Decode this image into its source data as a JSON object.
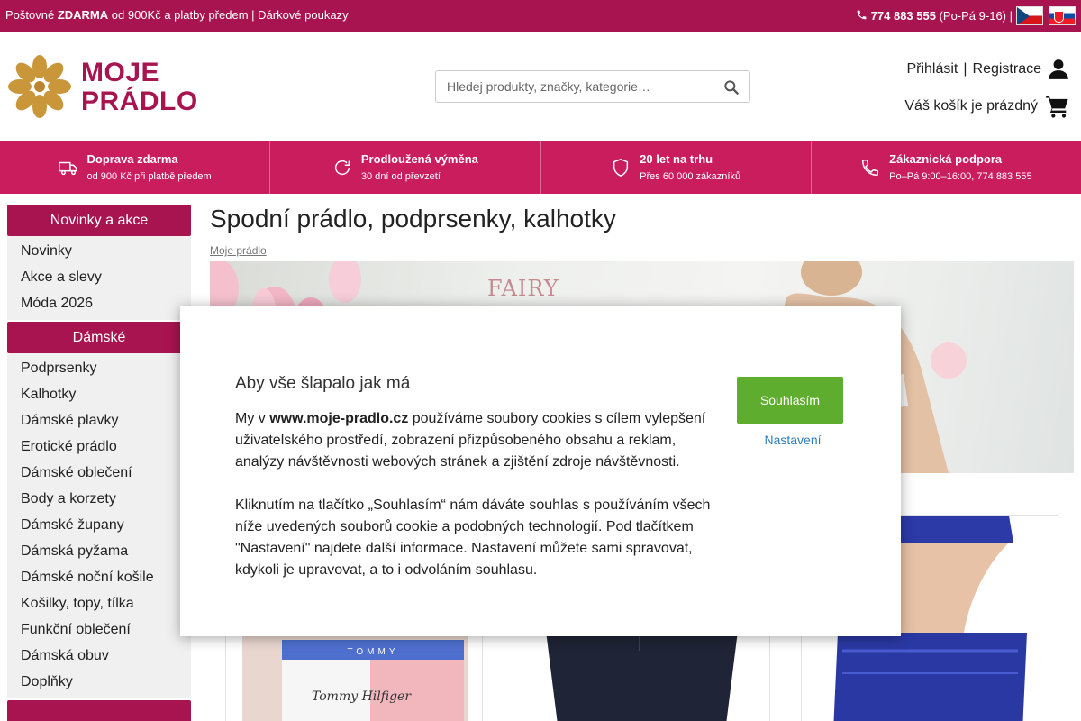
{
  "topbar": {
    "promo_prefix": "Poštovné ",
    "promo_bold": "ZDARMA",
    "promo_suffix": " od 900Kč a platby předem | Dárkové poukazy",
    "phone": "774 883 555",
    "hours": " (Po-Pá 9-16) |",
    "languages": [
      "cz",
      "sk"
    ]
  },
  "header": {
    "logo_line1": "MOJE",
    "logo_line2": "PRÁDLO",
    "search_placeholder": "Hledej produkty, značky, kategorie…",
    "login": "Přihlásit",
    "separator": "|",
    "register": "Registrace",
    "cart": "Váš košík je prázdný"
  },
  "benefits": [
    {
      "title": "Doprava zdarma",
      "subtitle": "od 900 Kč při platbě předem",
      "icon": "truck-icon"
    },
    {
      "title": "Prodloužená výměna",
      "subtitle": "30 dní od převzetí",
      "icon": "refresh-icon"
    },
    {
      "title": "20 let na trhu",
      "subtitle": "Přes 60 000 zákazníků",
      "icon": "shield-icon"
    },
    {
      "title": "Zákaznická podpora",
      "subtitle": "Po–Pá 9:00–16:00, 774 883 555",
      "icon": "phone-icon"
    }
  ],
  "sidebar": {
    "groups": [
      {
        "title": "Novinky a akce",
        "items": [
          "Novinky",
          "Akce a slevy",
          "Móda 2026"
        ]
      },
      {
        "title": "Dámské",
        "items": [
          "Podprsenky",
          "Kalhotky",
          "Dámské plavky",
          "Erotické prádlo",
          "Dámské oblečení",
          "Body a korzety",
          "Dámské župany",
          "Dámská pyžama",
          "Dámské noční košile",
          "Košilky, topy, tílka",
          "Funkční oblečení",
          "Dámská obuv",
          "Doplňky"
        ]
      }
    ]
  },
  "main": {
    "title": "Spodní prádlo, podprsenky, kalhotky",
    "breadcrumb": "Moje prádlo",
    "banner_brand": "FAIRY",
    "product_brand_1": "TOMMY",
    "product_brand_1_script": "Tommy Hilfiger"
  },
  "cookie": {
    "title": "Aby vše šlapalo jak má",
    "p1_prefix": "My v ",
    "p1_site": "www.moje-pradlo.cz",
    "p1_suffix": " používáme soubory cookies s cílem vylepšení uživatelského prostředí, zobrazení přizpůsobeného obsahu a reklam, analýzy návštěvnosti webových stránek a zjištění zdroje návštěvnosti.",
    "p2": "Kliknutím na tlačítko „Souhlasím“ nám dáváte souhlas s používáním všech níže uvedených souborů cookie a podobných technologií. Pod tlačítkem \"Nastavení\" najdete další informace. Nastavení můžete sami spravovat, kdykoli je upravovat, a to i odvoláním souhlasu.",
    "agree": "Souhlasím",
    "settings": "Nastavení"
  },
  "colors": {
    "brand": "#a8144f",
    "benefits_bar": "#c91d5e",
    "logo_flower": "#c9973a",
    "agree_button": "#5fad2e",
    "settings_link": "#2d7cb6"
  }
}
